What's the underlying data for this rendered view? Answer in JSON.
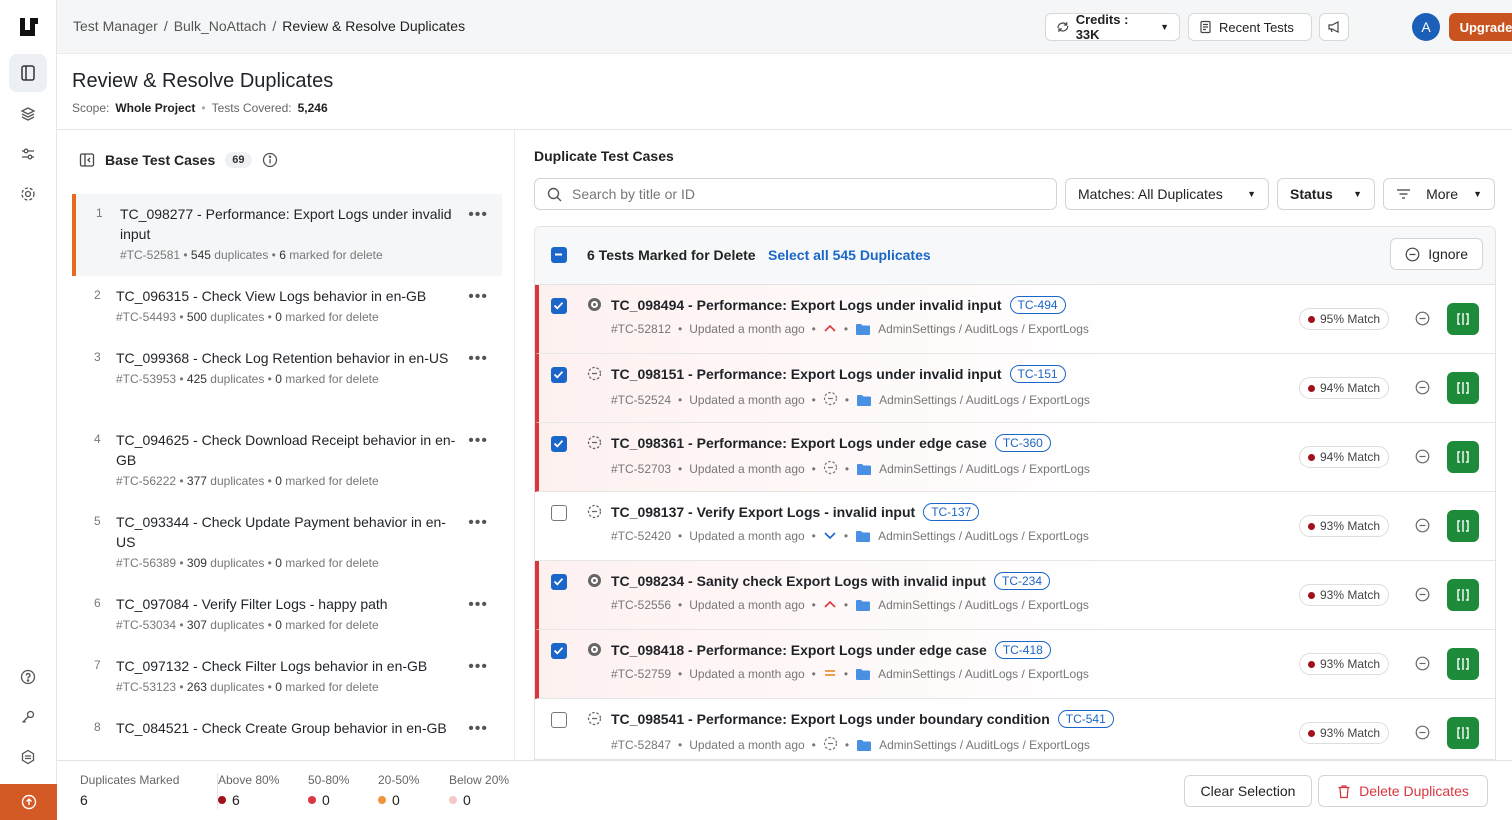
{
  "breadcrumb": [
    "Test Manager",
    "Bulk_NoAttach",
    "Review & Resolve Duplicates"
  ],
  "topbar": {
    "credits": "Credits : 33K",
    "recent_tests": "Recent Tests",
    "avatar": "A",
    "upgrade": "Upgrade Now"
  },
  "header": {
    "title": "Review & Resolve Duplicates",
    "scope_label": "Scope:",
    "scope_value": "Whole Project",
    "covered_label": "Tests Covered:",
    "covered_value": "5,246"
  },
  "base": {
    "title": "Base Test Cases",
    "count": "69",
    "items": [
      {
        "n": "1",
        "title": "TC_098277 - Performance: Export Logs under invalid input",
        "id": "#TC-52581",
        "dups": "545",
        "dups_label": "duplicates",
        "marked": "6",
        "marked_label": "marked for delete"
      },
      {
        "n": "2",
        "title": "TC_096315 - Check View Logs behavior in en-GB",
        "id": "#TC-54493",
        "dups": "500",
        "dups_label": "duplicates",
        "marked": "0",
        "marked_label": "marked for delete"
      },
      {
        "n": "3",
        "title": "TC_099368 - Check Log Retention behavior in en-US",
        "id": "#TC-53953",
        "dups": "425",
        "dups_label": "duplicates",
        "marked": "0",
        "marked_label": "marked for delete"
      },
      {
        "n": "4",
        "title": "TC_094625 - Check Download Receipt behavior in en-GB",
        "id": "#TC-56222",
        "dups": "377",
        "dups_label": "duplicates",
        "marked": "0",
        "marked_label": "marked for delete"
      },
      {
        "n": "5",
        "title": "TC_093344 - Check Update Payment behavior in en-US",
        "id": "#TC-56389",
        "dups": "309",
        "dups_label": "duplicates",
        "marked": "0",
        "marked_label": "marked for delete"
      },
      {
        "n": "6",
        "title": "TC_097084 - Verify Filter Logs - happy path",
        "id": "#TC-53034",
        "dups": "307",
        "dups_label": "duplicates",
        "marked": "0",
        "marked_label": "marked for delete"
      },
      {
        "n": "7",
        "title": "TC_097132 - Check Filter Logs behavior in en-GB",
        "id": "#TC-53123",
        "dups": "263",
        "dups_label": "duplicates",
        "marked": "0",
        "marked_label": "marked for delete"
      },
      {
        "n": "8",
        "title": "TC_084521 - Check Create Group behavior in en-GB",
        "id": "",
        "dups": "",
        "dups_label": "",
        "marked": "",
        "marked_label": ""
      }
    ]
  },
  "dup": {
    "title": "Duplicate Test Cases",
    "search_placeholder": "Search by title or ID",
    "filter_matches": "Matches: All Duplicates",
    "filter_status": "Status",
    "filter_more": "More",
    "bar_text": "6 Tests Marked for Delete",
    "select_all": "Select all 545 Duplicates",
    "ignore": "Ignore",
    "rows": [
      {
        "checked": true,
        "title": "TC_098494 - Performance: Export Logs under invalid input",
        "tag": "TC-494",
        "id": "#TC-52812",
        "updated": "Updated a month ago",
        "priority": "high",
        "path": "AdminSettings / AuditLogs / ExportLogs",
        "match": "95% Match"
      },
      {
        "checked": true,
        "title": "TC_098151 - Performance: Export Logs under invalid input",
        "tag": "TC-151",
        "id": "#TC-52524",
        "updated": "Updated a month ago",
        "priority": "none",
        "path": "AdminSettings / AuditLogs / ExportLogs",
        "match": "94% Match"
      },
      {
        "checked": true,
        "title": "TC_098361 - Performance: Export Logs under edge case",
        "tag": "TC-360",
        "id": "#TC-52703",
        "updated": "Updated a month ago",
        "priority": "none",
        "path": "AdminSettings / AuditLogs / ExportLogs",
        "match": "94% Match"
      },
      {
        "checked": false,
        "title": "TC_098137 - Verify Export Logs - invalid input",
        "tag": "TC-137",
        "id": "#TC-52420",
        "updated": "Updated a month ago",
        "priority": "low",
        "path": "AdminSettings / AuditLogs / ExportLogs",
        "match": "93% Match"
      },
      {
        "checked": true,
        "title": "TC_098234 - Sanity check Export Logs with invalid input",
        "tag": "TC-234",
        "id": "#TC-52556",
        "updated": "Updated a month ago",
        "priority": "high",
        "path": "AdminSettings / AuditLogs / ExportLogs",
        "match": "93% Match"
      },
      {
        "checked": true,
        "title": "TC_098418 - Performance: Export Logs under edge case",
        "tag": "TC-418",
        "id": "#TC-52759",
        "updated": "Updated a month ago",
        "priority": "medium",
        "path": "AdminSettings / AuditLogs / ExportLogs",
        "match": "93% Match"
      },
      {
        "checked": false,
        "title": "TC_098541 - Performance: Export Logs under boundary condition",
        "tag": "TC-541",
        "id": "#TC-52847",
        "updated": "Updated a month ago",
        "priority": "none",
        "path": "AdminSettings / AuditLogs / ExportLogs",
        "match": "93% Match"
      }
    ]
  },
  "footer": {
    "stats": [
      {
        "label": "Duplicates Marked",
        "value": "6",
        "color": ""
      },
      {
        "label": "Above 80%",
        "value": "6",
        "color": "#a1111c"
      },
      {
        "label": "50-80%",
        "value": "0",
        "color": "#d9363e"
      },
      {
        "label": "20-50%",
        "value": "0",
        "color": "#f0933c"
      },
      {
        "label": "Below 20%",
        "value": "0",
        "color": "#f3c9c6"
      }
    ],
    "clear": "Clear Selection",
    "delete": "Delete Duplicates"
  },
  "colors": {
    "accent": "#1b66c9",
    "brand": "#c9531f",
    "danger": "#d9363e",
    "success": "#1e8b3b"
  }
}
